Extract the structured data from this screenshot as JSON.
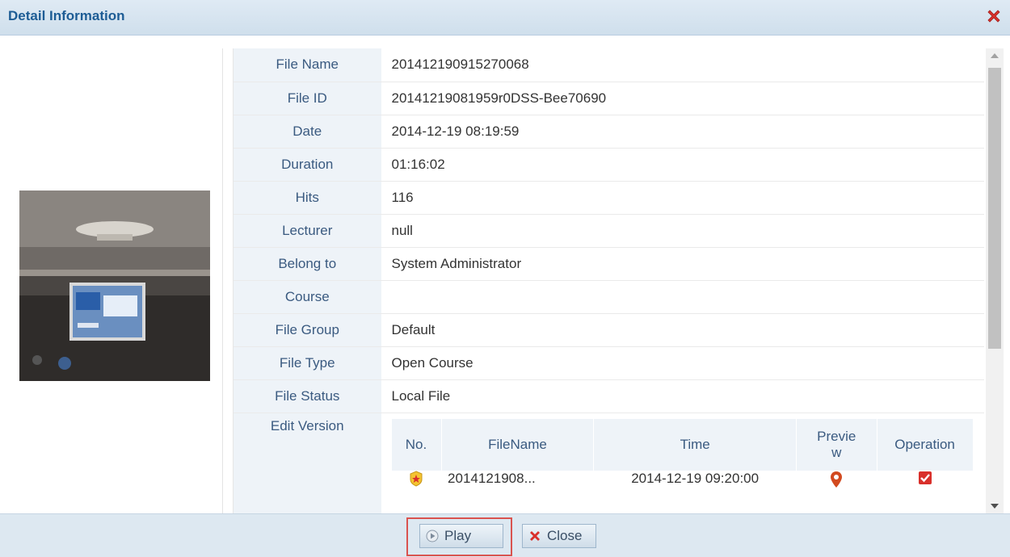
{
  "dialog": {
    "title": "Detail Information"
  },
  "details": [
    {
      "label": "File Name",
      "value": "201412190915270068"
    },
    {
      "label": "File ID",
      "value": "20141219081959r0DSS-Bee70690"
    },
    {
      "label": "Date",
      "value": "2014-12-19 08:19:59"
    },
    {
      "label": "Duration",
      "value": "01:16:02"
    },
    {
      "label": "Hits",
      "value": "116"
    },
    {
      "label": "Lecturer",
      "value": "null"
    },
    {
      "label": "Belong to",
      "value": "System Administrator"
    },
    {
      "label": "Course",
      "value": ""
    },
    {
      "label": "File Group",
      "value": "Default"
    },
    {
      "label": "File Type",
      "value": "Open Course"
    },
    {
      "label": "File Status",
      "value": "Local File"
    }
  ],
  "edit_version": {
    "label": "Edit Version",
    "columns": {
      "no": "No.",
      "filename": "FileName",
      "time": "Time",
      "preview_1": "Previe",
      "preview_2": "w",
      "operation": "Operation"
    },
    "rows": [
      {
        "filename": "2014121908...",
        "time": "2014-12-19 09:20:00",
        "checked": true
      }
    ]
  },
  "footer": {
    "play_label": "Play",
    "close_label": "Close"
  },
  "colors": {
    "title_text": "#1d5c95",
    "label_text": "#3a5a80",
    "label_bg": "#eef3f8",
    "highlight": "#d9534f",
    "close_red": "#d9302b"
  },
  "icons": {
    "close": "close-x-icon",
    "play": "play-circle-icon",
    "cancel": "red-x-icon",
    "badge": "star-badge-icon",
    "location": "map-pin-icon",
    "checkbox": "checked-box-icon"
  }
}
